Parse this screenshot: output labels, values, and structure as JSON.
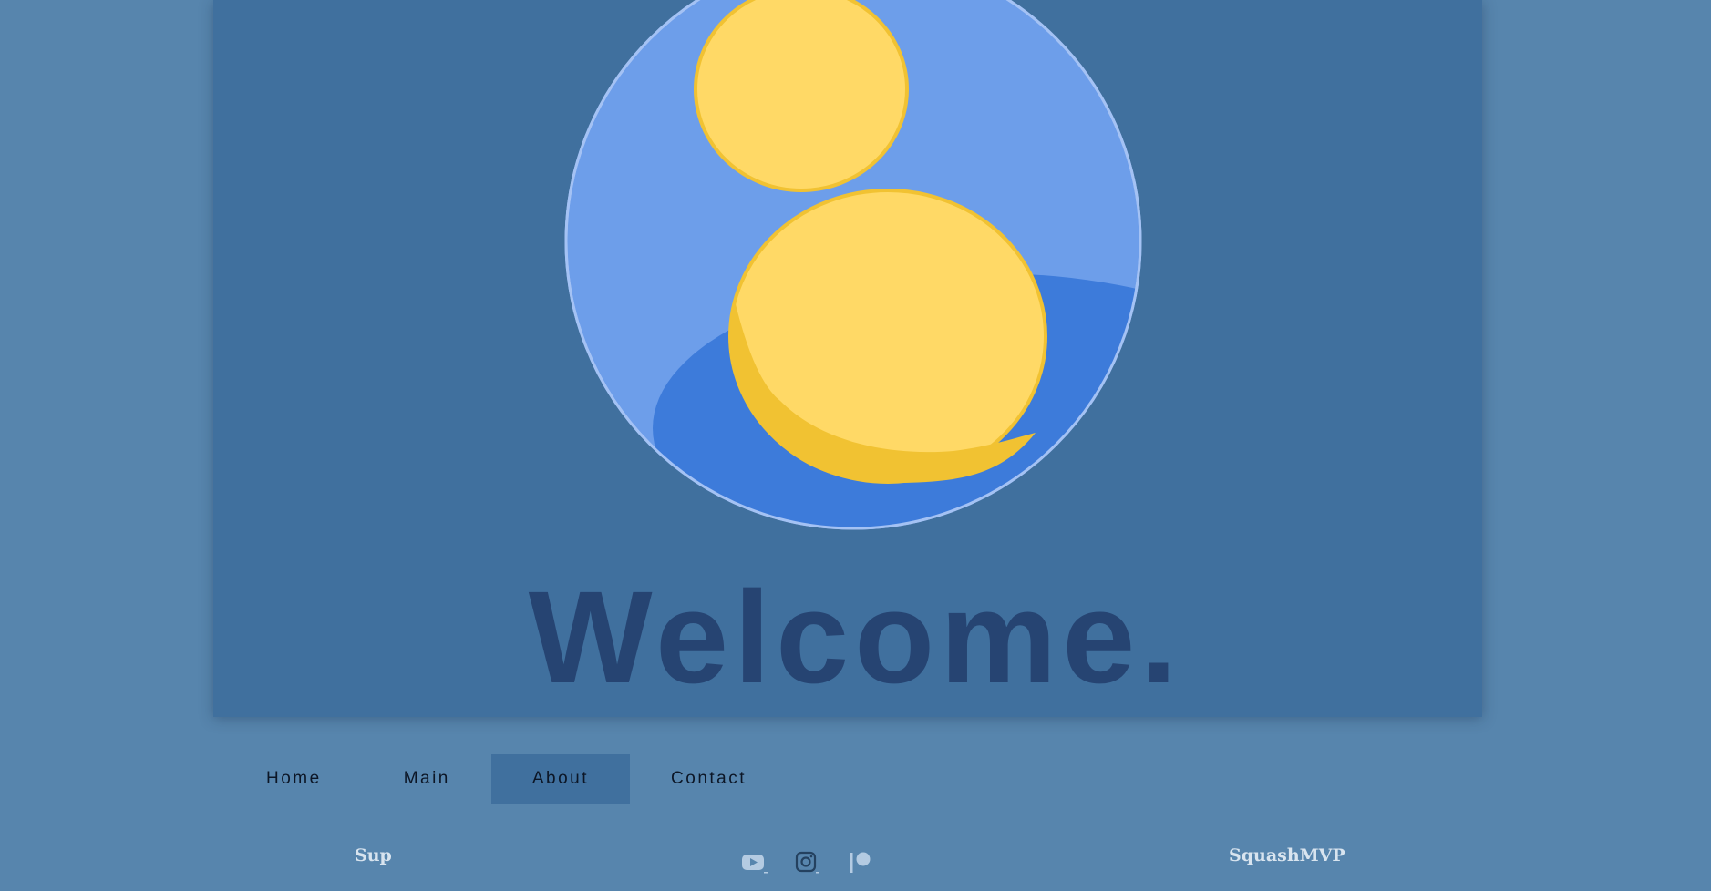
{
  "hero": {
    "avatar_icon": "user-avatar-icon",
    "heading": "Welcome."
  },
  "nav": {
    "items": [
      {
        "label": "Home",
        "active": false
      },
      {
        "label": "Main",
        "active": false
      },
      {
        "label": "About",
        "active": true
      },
      {
        "label": "Contact",
        "active": false
      }
    ]
  },
  "footer": {
    "left_text": "Sup",
    "right_text": "SquashMVP",
    "social_icons": [
      "youtube-icon",
      "instagram-icon",
      "patreon-icon"
    ]
  },
  "colors": {
    "page_background": "#5785ad",
    "hero_background": "#40709e",
    "heading": "#264472",
    "avatar_circle": "#6d9eea",
    "avatar_accent": "#3d7bda",
    "avatar_figure": "#ffd966",
    "avatar_figure_shadow": "#f1c232"
  }
}
